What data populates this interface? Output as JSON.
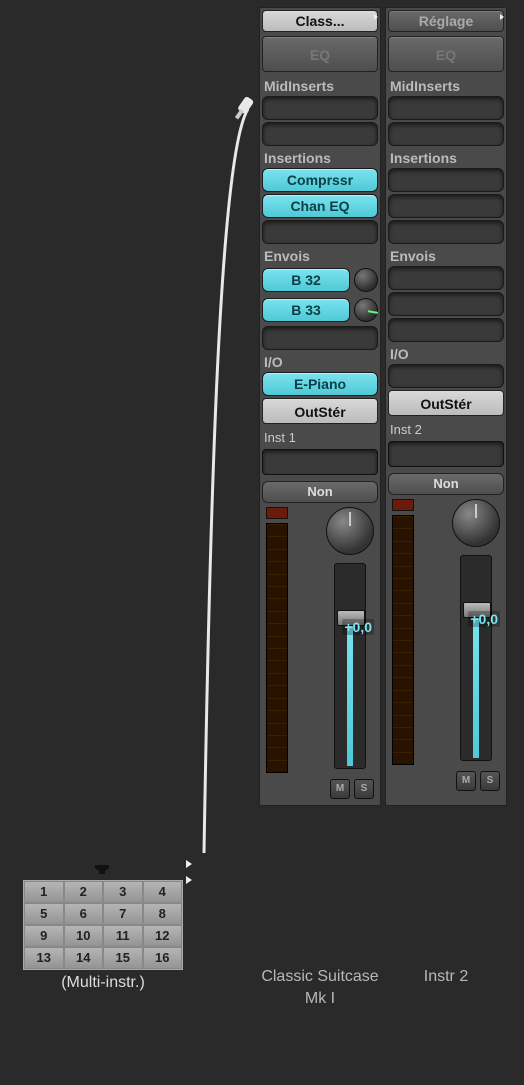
{
  "multi": {
    "label": "(Multi-instr.)",
    "cells": [
      "1",
      "2",
      "3",
      "4",
      "5",
      "6",
      "7",
      "8",
      "9",
      "10",
      "11",
      "12",
      "13",
      "14",
      "15",
      "16"
    ]
  },
  "strips": [
    {
      "preset": "Class...",
      "eq_label": "EQ",
      "midinserts_label": "MidInserts",
      "insertions_label": "Insertions",
      "inserts": [
        "Comprssr",
        "Chan EQ"
      ],
      "envois_label": "Envois",
      "sends": [
        "B 32",
        "B 33"
      ],
      "io_label": "I/O",
      "input": "E-Piano",
      "output": "OutStér",
      "inst_label": "Inst 1",
      "group_label": "Non",
      "db": "+0,0",
      "mute_label": "M",
      "solo_label": "S",
      "name": "Classic Suitcase Mk I"
    },
    {
      "preset": "Réglage",
      "eq_label": "EQ",
      "midinserts_label": "MidInserts",
      "insertions_label": "Insertions",
      "inserts": [],
      "envois_label": "Envois",
      "sends": [],
      "io_label": "I/O",
      "input": "",
      "output": "OutStér",
      "inst_label": "Inst 2",
      "group_label": "Non",
      "db": "+0,0",
      "mute_label": "M",
      "solo_label": "S",
      "name": "Instr 2"
    }
  ]
}
